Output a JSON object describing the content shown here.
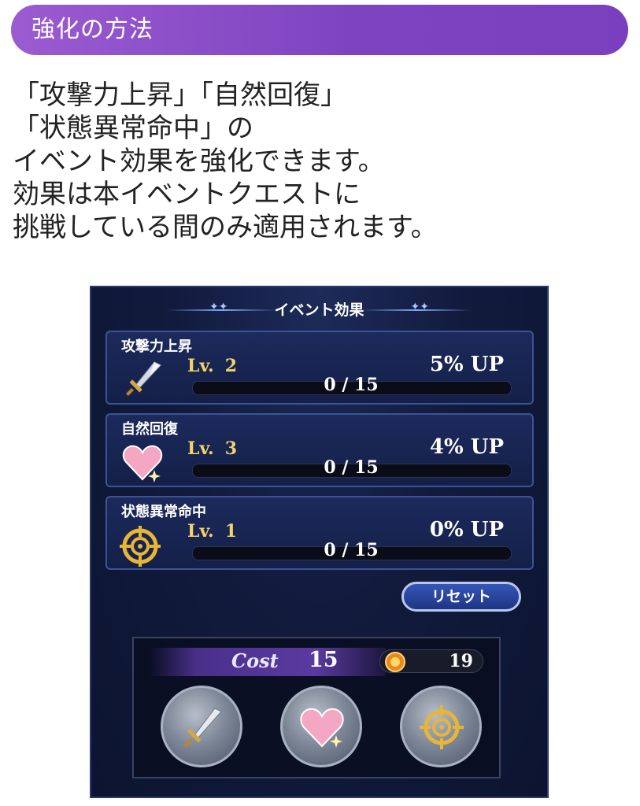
{
  "header": {
    "title": "強化の方法"
  },
  "description": {
    "lines": [
      "「攻撃力上昇」「自然回復」",
      "「状態異常命中」の",
      "イベント効果を強化できます。",
      "効果は本イベントクエストに",
      "挑戦している間のみ適用されます。"
    ]
  },
  "panel": {
    "title": "イベント効果",
    "effects": [
      {
        "name": "攻撃力上昇",
        "icon": "sword-icon",
        "lv_label": "Lv.",
        "level": "2",
        "bonus": "5% UP",
        "progress": "0 / 15"
      },
      {
        "name": "自然回復",
        "icon": "heart-icon",
        "lv_label": "Lv.",
        "level": "3",
        "bonus": "4% UP",
        "progress": "0 / 15"
      },
      {
        "name": "状態異常命中",
        "icon": "crosshair-icon",
        "lv_label": "Lv.",
        "level": "1",
        "bonus": "0% UP",
        "progress": "0 / 15"
      }
    ],
    "reset_label": "リセット",
    "cost_label": "Cost",
    "cost_value": "15",
    "coin_count": "19",
    "buttons": [
      "sword-icon",
      "heart-icon",
      "crosshair-icon"
    ]
  },
  "colors": {
    "header_bg": "#8a4fc8",
    "panel_bg": "#121b3d",
    "level_text": "#f2d36a",
    "row_border": "#3b5496"
  }
}
